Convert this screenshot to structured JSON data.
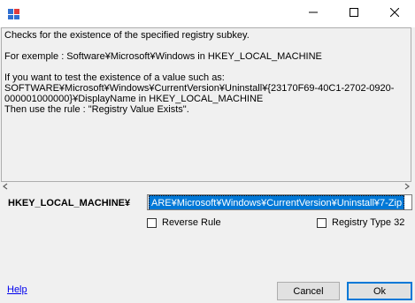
{
  "window": {
    "min_icon": "minimize-icon",
    "max_icon": "maximize-icon",
    "close_icon": "close-icon"
  },
  "description": "Checks for the existence of the specified registry subkey.\n\nFor exemple : Software¥Microsoft¥Windows in HKEY_LOCAL_MACHINE\n\nIf you want to test the existence of a value such as:\nSOFTWARE¥Microsoft¥Windows¥CurrentVersion¥Uninstall¥{23170F69-40C1-2702-0920-000001000000}¥DisplayName in HKEY_LOCAL_MACHINE\nThen use the rule : \"Registry Value Exists\".",
  "hive_label": "HKEY_LOCAL_MACHINE¥",
  "path_value": "ARE¥Microsoft¥Windows¥CurrentVersion¥Uninstall¥7-Zip",
  "reverse_rule_label": "Reverse Rule",
  "registry32_label": "Registry Type 32",
  "help_label": "Help",
  "cancel_label": "Cancel",
  "ok_label": "Ok",
  "colors": {
    "selection": "#0078d7",
    "link": "#0000ee"
  }
}
